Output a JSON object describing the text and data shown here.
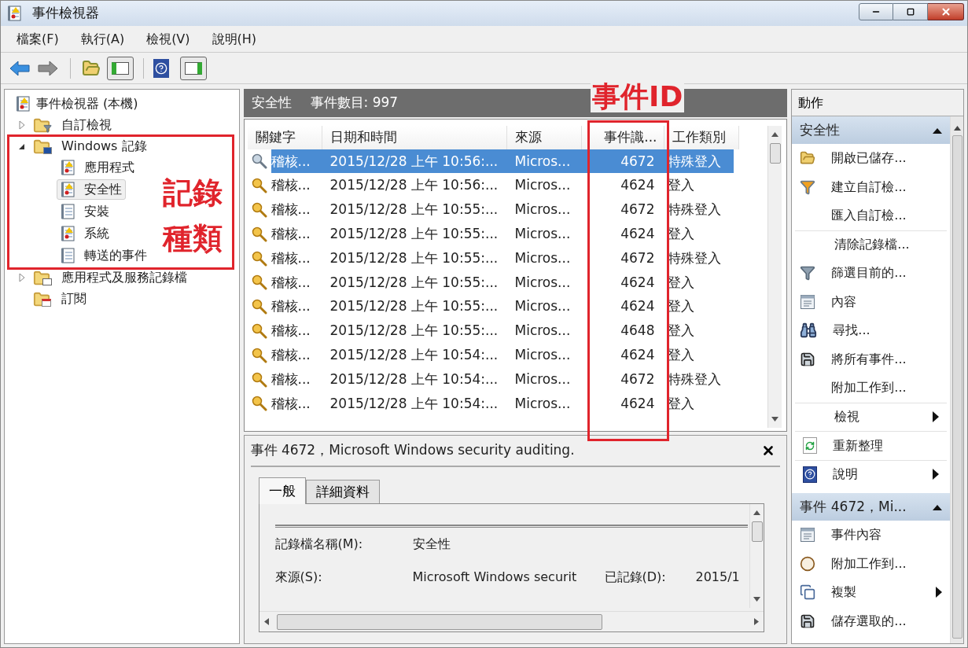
{
  "window": {
    "title": "事件檢視器"
  },
  "menu": [
    "檔案(F)",
    "執行(A)",
    "檢視(V)",
    "說明(H)"
  ],
  "tree": {
    "label": "事件檢視器 (本機)",
    "children": [
      {
        "label": "自訂檢視",
        "kind": "filter_folder",
        "expanded": false
      },
      {
        "label": "Windows 記錄",
        "kind": "windows_folder",
        "expanded": true,
        "children": [
          {
            "label": "應用程式",
            "kind": "alert_log",
            "selected": false
          },
          {
            "label": "安全性",
            "kind": "alert_log",
            "selected": true
          },
          {
            "label": "安裝",
            "kind": "plain_log",
            "selected": false
          },
          {
            "label": "系統",
            "kind": "alert_log",
            "selected": false
          },
          {
            "label": "轉送的事件",
            "kind": "plain_log",
            "selected": false
          }
        ]
      },
      {
        "label": "應用程式及服務記錄檔",
        "kind": "app_folder",
        "expanded": false
      },
      {
        "label": "訂閱",
        "kind": "subscription"
      }
    ]
  },
  "log_header": {
    "name": "安全性",
    "count": "事件數目: 997"
  },
  "table": {
    "columns": [
      "關鍵字",
      "日期和時間",
      "來源",
      "事件識...",
      "工作類別"
    ],
    "rows": [
      {
        "keyword": "稽核...",
        "date": "2015/12/28 上午 10:56:...",
        "source": "Micros...",
        "event_id": "4672",
        "task": "特殊登入",
        "selected": true
      },
      {
        "keyword": "稽核...",
        "date": "2015/12/28 上午 10:56:...",
        "source": "Micros...",
        "event_id": "4624",
        "task": "登入",
        "selected": false
      },
      {
        "keyword": "稽核...",
        "date": "2015/12/28 上午 10:55:...",
        "source": "Micros...",
        "event_id": "4672",
        "task": "特殊登入",
        "selected": false
      },
      {
        "keyword": "稽核...",
        "date": "2015/12/28 上午 10:55:...",
        "source": "Micros...",
        "event_id": "4624",
        "task": "登入",
        "selected": false
      },
      {
        "keyword": "稽核...",
        "date": "2015/12/28 上午 10:55:...",
        "source": "Micros...",
        "event_id": "4672",
        "task": "特殊登入",
        "selected": false
      },
      {
        "keyword": "稽核...",
        "date": "2015/12/28 上午 10:55:...",
        "source": "Micros...",
        "event_id": "4624",
        "task": "登入",
        "selected": false
      },
      {
        "keyword": "稽核...",
        "date": "2015/12/28 上午 10:55:...",
        "source": "Micros...",
        "event_id": "4624",
        "task": "登入",
        "selected": false
      },
      {
        "keyword": "稽核...",
        "date": "2015/12/28 上午 10:55:...",
        "source": "Micros...",
        "event_id": "4648",
        "task": "登入",
        "selected": false
      },
      {
        "keyword": "稽核...",
        "date": "2015/12/28 上午 10:54:...",
        "source": "Micros...",
        "event_id": "4624",
        "task": "登入",
        "selected": false
      },
      {
        "keyword": "稽核...",
        "date": "2015/12/28 上午 10:54:...",
        "source": "Micros...",
        "event_id": "4672",
        "task": "特殊登入",
        "selected": false
      },
      {
        "keyword": "稽核...",
        "date": "2015/12/28 上午 10:54:...",
        "source": "Micros...",
        "event_id": "4624",
        "task": "登入",
        "selected": false
      }
    ]
  },
  "detail": {
    "title": "事件 4672，Microsoft Windows security auditing.",
    "tabs": [
      {
        "label": "一般",
        "selected": true
      },
      {
        "label": "詳細資料",
        "selected": false
      }
    ],
    "fields": [
      {
        "label": "記錄檔名稱(M):",
        "value": "安全性"
      },
      {
        "label": "來源(S):",
        "value": "Microsoft Windows securit",
        "label_2": "已記錄(D):",
        "value_2": "2015/1"
      }
    ]
  },
  "actions": {
    "title": "動作",
    "sections": [
      {
        "title": "安全性",
        "expanded": true,
        "items": [
          {
            "label": "開啟已儲存...",
            "kind": "folder",
            "submenu": false,
            "separator_before": false
          },
          {
            "label": "建立自訂檢...",
            "kind": "filter",
            "submenu": false,
            "separator_before": false
          },
          {
            "label": "匯入自訂檢...",
            "kind": "none",
            "submenu": false,
            "separator_before": false
          },
          {
            "label": "清除記錄檔...",
            "kind": "none",
            "submenu": false,
            "separator_before": true
          },
          {
            "label": "篩選目前的...",
            "kind": "filter_gray",
            "submenu": false,
            "separator_before": false
          },
          {
            "label": "內容",
            "kind": "properties",
            "submenu": false,
            "separator_before": false
          },
          {
            "label": "尋找...",
            "kind": "find",
            "submenu": false,
            "separator_before": false
          },
          {
            "label": "將所有事件...",
            "kind": "save",
            "submenu": false,
            "separator_before": false
          },
          {
            "label": "附加工作到...",
            "kind": "none",
            "submenu": false,
            "separator_before": false
          },
          {
            "label": "檢視",
            "kind": "none",
            "submenu": true,
            "separator_before": true
          },
          {
            "label": "重新整理",
            "kind": "refresh",
            "submenu": false,
            "separator_before": true
          },
          {
            "label": "說明",
            "kind": "help",
            "submenu": true,
            "separator_before": true
          }
        ]
      },
      {
        "title": "事件 4672，Mi...",
        "expanded": true,
        "items": [
          {
            "label": "事件內容",
            "kind": "properties",
            "submenu": false,
            "separator_before": false
          },
          {
            "label": "附加工作到...",
            "kind": "task",
            "submenu": false,
            "separator_before": false
          },
          {
            "label": "複製",
            "kind": "copy",
            "submenu": true,
            "separator_before": false
          },
          {
            "label": "儲存選取的...",
            "kind": "save",
            "submenu": false,
            "separator_before": false
          }
        ]
      }
    ]
  },
  "annotations": {
    "log_types": [
      "記錄",
      "種類"
    ],
    "event_id": "事件ID"
  }
}
